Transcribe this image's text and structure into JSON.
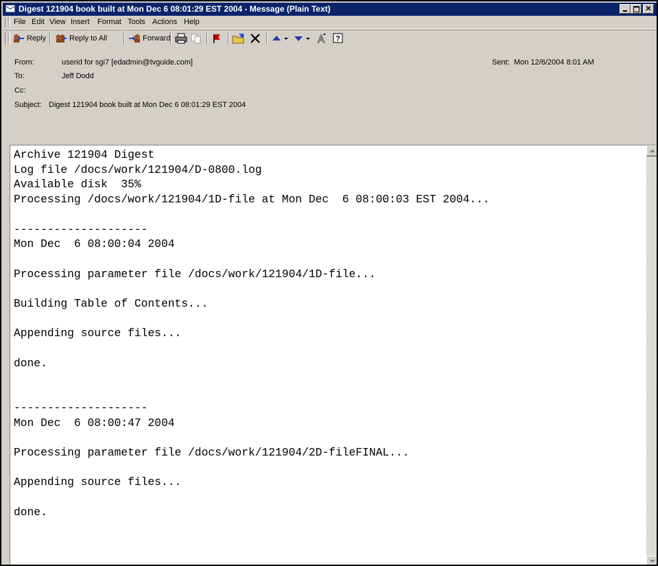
{
  "window": {
    "title": "Digest 121904 book built at Mon Dec  6 08:01:29 EST 2004 - Message (Plain Text)"
  },
  "menu": {
    "items": [
      "File",
      "Edit",
      "View",
      "Insert",
      "Format",
      "Tools",
      "Actions",
      "Help"
    ]
  },
  "toolbar": {
    "reply_label": "Reply",
    "reply_all_label": "Reply to All",
    "forward_label": "Forward"
  },
  "headers": {
    "from_label": "From:",
    "from_value": "userid for sgi7 [edadmin@tvguide.com]",
    "to_label": "To:",
    "to_value": "Jeff Dodd",
    "cc_label": "Cc:",
    "cc_value": "",
    "subject_label": "Subject:",
    "subject_value": "Digest 121904 book built at Mon Dec  6 08:01:29 EST 2004",
    "sent_label": "Sent:",
    "sent_value": "Mon 12/6/2004 8:01 AM"
  },
  "body": {
    "lines": [
      "Archive 121904 Digest",
      "Log file /docs/work/121904/D-0800.log",
      "Available disk  35%",
      "Processing /docs/work/121904/1D-file at Mon Dec  6 08:00:03 EST 2004...",
      "",
      "--------------------",
      "Mon Dec  6 08:00:04 2004",
      "",
      "Processing parameter file /docs/work/121904/1D-file...",
      "",
      "Building Table of Contents...",
      "",
      "Appending source files...",
      "",
      "done.",
      "",
      "",
      "--------------------",
      "Mon Dec  6 08:00:47 2004",
      "",
      "Processing parameter file /docs/work/121904/2D-fileFINAL...",
      "",
      "Appending source files...",
      "",
      "done."
    ]
  },
  "colors": {
    "titlebar": "#0a246a",
    "chrome": "#d4d0c8"
  }
}
